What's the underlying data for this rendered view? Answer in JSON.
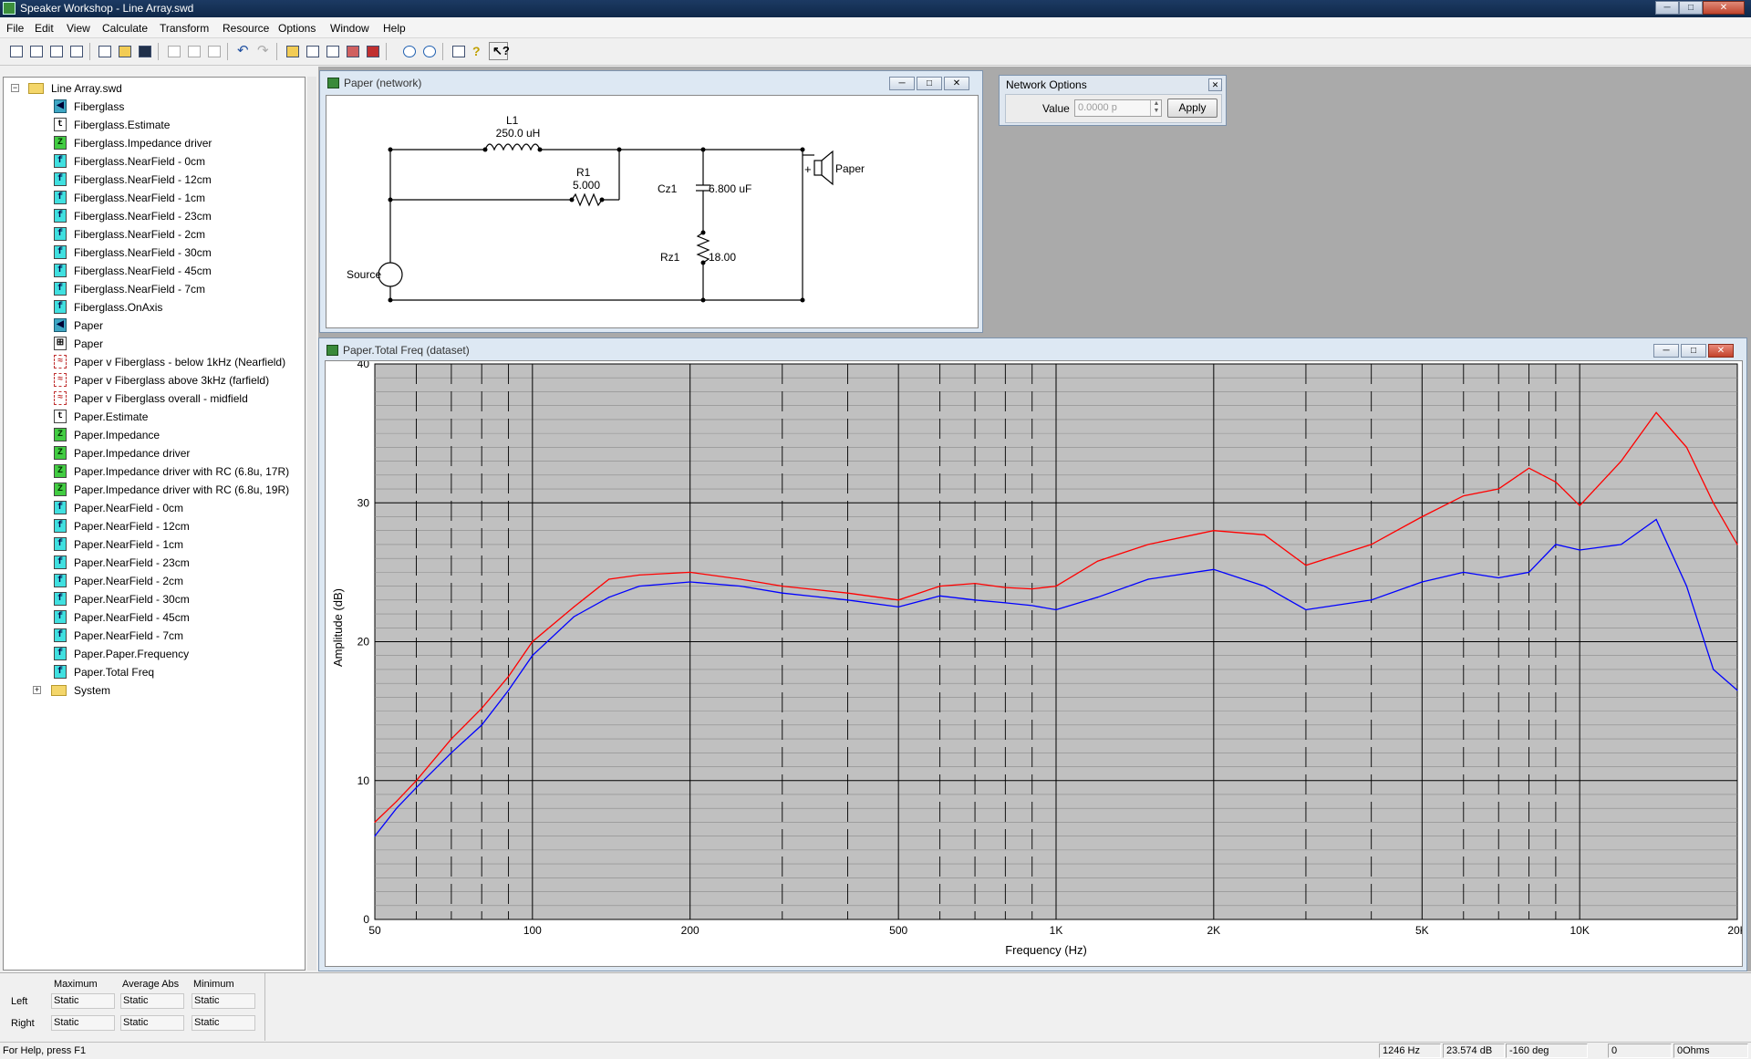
{
  "window": {
    "title": "Speaker Workshop - Line Array.swd",
    "minimize": "─",
    "maximize": "□",
    "close": "✕"
  },
  "menu": [
    "File",
    "Edit",
    "View",
    "Calculate",
    "Transform",
    "Resource",
    "Options",
    "Window",
    "Help"
  ],
  "tree": {
    "root": "Line Array.swd",
    "items": [
      {
        "label": "Fiberglass",
        "icon": "speaker-icon"
      },
      {
        "label": "Fiberglass.Estimate",
        "icon": "text-icon"
      },
      {
        "label": "Fiberglass.Impedance driver",
        "icon": "impedance-icon"
      },
      {
        "label": "Fiberglass.NearField - 0cm",
        "icon": "frequency-icon"
      },
      {
        "label": "Fiberglass.NearField - 12cm",
        "icon": "frequency-icon"
      },
      {
        "label": "Fiberglass.NearField - 1cm",
        "icon": "frequency-icon"
      },
      {
        "label": "Fiberglass.NearField - 23cm",
        "icon": "frequency-icon"
      },
      {
        "label": "Fiberglass.NearField - 2cm",
        "icon": "frequency-icon"
      },
      {
        "label": "Fiberglass.NearField - 30cm",
        "icon": "frequency-icon"
      },
      {
        "label": "Fiberglass.NearField - 45cm",
        "icon": "frequency-icon"
      },
      {
        "label": "Fiberglass.NearField - 7cm",
        "icon": "frequency-icon"
      },
      {
        "label": "Fiberglass.OnAxis",
        "icon": "frequency-icon"
      },
      {
        "label": "Paper",
        "icon": "speaker-icon"
      },
      {
        "label": "Paper",
        "icon": "network-icon"
      },
      {
        "label": "Paper v Fiberglass - below 1kHz (Nearfield)",
        "icon": "overlay-icon"
      },
      {
        "label": "Paper v Fiberglass above 3kHz (farfield)",
        "icon": "overlay-icon"
      },
      {
        "label": "Paper v Fiberglass overall - midfield",
        "icon": "overlay-icon"
      },
      {
        "label": "Paper.Estimate",
        "icon": "text-icon"
      },
      {
        "label": "Paper.Impedance",
        "icon": "impedance-icon"
      },
      {
        "label": "Paper.Impedance driver",
        "icon": "impedance-icon"
      },
      {
        "label": "Paper.Impedance driver with RC (6.8u, 17R)",
        "icon": "impedance-icon"
      },
      {
        "label": "Paper.Impedance driver with RC (6.8u, 19R)",
        "icon": "impedance-icon"
      },
      {
        "label": "Paper.NearField - 0cm",
        "icon": "frequency-icon"
      },
      {
        "label": "Paper.NearField - 12cm",
        "icon": "frequency-icon"
      },
      {
        "label": "Paper.NearField - 1cm",
        "icon": "frequency-icon"
      },
      {
        "label": "Paper.NearField - 23cm",
        "icon": "frequency-icon"
      },
      {
        "label": "Paper.NearField - 2cm",
        "icon": "frequency-icon"
      },
      {
        "label": "Paper.NearField - 30cm",
        "icon": "frequency-icon"
      },
      {
        "label": "Paper.NearField - 45cm",
        "icon": "frequency-icon"
      },
      {
        "label": "Paper.NearField - 7cm",
        "icon": "frequency-icon"
      },
      {
        "label": "Paper.Paper.Frequency",
        "icon": "frequency-icon"
      },
      {
        "label": "Paper.Total Freq",
        "icon": "frequency-icon"
      }
    ],
    "system": "System"
  },
  "network_window": {
    "title": "Paper (network)",
    "labels": {
      "l1_name": "L1",
      "l1_value": "250.0 uH",
      "r1_name": "R1",
      "r1_value": "5.000",
      "cz1_name": "Cz1",
      "cz1_value": "6.800 uF",
      "rz1_name": "Rz1",
      "rz1_value": "18.00",
      "source": "Source",
      "driver": "Paper",
      "plus": "+"
    }
  },
  "network_options": {
    "title": "Network Options",
    "value_label": "Value",
    "value": "0.0000 p",
    "apply": "Apply"
  },
  "chart_window": {
    "title": "Paper.Total Freq (dataset)"
  },
  "chart_data": {
    "type": "line",
    "title": "",
    "xlabel": "Frequency (Hz)",
    "ylabel": "Amplitude (dB)",
    "xscale": "log",
    "xlim": [
      50,
      20000
    ],
    "ylim": [
      0,
      40
    ],
    "x_ticks": [
      {
        "v": 50,
        "label": "50"
      },
      {
        "v": 100,
        "label": "100"
      },
      {
        "v": 200,
        "label": "200"
      },
      {
        "v": 500,
        "label": "500"
      },
      {
        "v": 1000,
        "label": "1K"
      },
      {
        "v": 2000,
        "label": "2K"
      },
      {
        "v": 5000,
        "label": "5K"
      },
      {
        "v": 10000,
        "label": "10K"
      },
      {
        "v": 20000,
        "label": "20K"
      }
    ],
    "y_ticks": [
      0,
      10,
      20,
      30,
      40
    ],
    "grid": true,
    "background": "#c0c0c0",
    "series": [
      {
        "color": "#ff0000",
        "x": [
          50,
          55,
          60,
          70,
          80,
          90,
          100,
          120,
          140,
          160,
          200,
          250,
          300,
          400,
          500,
          600,
          700,
          800,
          900,
          1000,
          1200,
          1500,
          2000,
          2500,
          3000,
          4000,
          5000,
          6000,
          7000,
          8000,
          9000,
          10000,
          12000,
          14000,
          16000,
          18000,
          20000
        ],
        "y": [
          7.0,
          8.5,
          10,
          13,
          15.2,
          17.5,
          20,
          22.5,
          24.5,
          24.8,
          25.0,
          24.5,
          24.0,
          23.5,
          23.0,
          24.0,
          24.2,
          23.9,
          23.8,
          24.0,
          25.8,
          27.0,
          28.0,
          27.7,
          25.5,
          27.0,
          29.0,
          30.5,
          31.0,
          32.5,
          31.5,
          29.8,
          33.0,
          36.5,
          34.0,
          30.0,
          27.0
        ]
      },
      {
        "color": "#0000ff",
        "x": [
          50,
          55,
          60,
          70,
          80,
          90,
          100,
          120,
          140,
          160,
          200,
          250,
          300,
          400,
          500,
          600,
          700,
          800,
          900,
          1000,
          1200,
          1500,
          2000,
          2500,
          3000,
          4000,
          5000,
          6000,
          7000,
          8000,
          9000,
          10000,
          12000,
          14000,
          16000,
          18000,
          20000
        ],
        "y": [
          6.0,
          8.0,
          9.5,
          12,
          14,
          16.5,
          19,
          21.8,
          23.2,
          24.0,
          24.3,
          24.0,
          23.5,
          23.0,
          22.5,
          23.3,
          23.0,
          22.8,
          22.6,
          22.3,
          23.2,
          24.5,
          25.2,
          24.0,
          22.3,
          23.0,
          24.3,
          25.0,
          24.6,
          25.0,
          27.0,
          26.6,
          27.0,
          28.8,
          24.0,
          18.0,
          16.5
        ]
      }
    ]
  },
  "stats": {
    "headers": [
      "Maximum",
      "Average Abs",
      "Minimum"
    ],
    "rows": [
      {
        "label": "Left",
        "values": [
          "Static",
          "Static",
          "Static"
        ]
      },
      {
        "label": "Right",
        "values": [
          "Static",
          "Static",
          "Static"
        ]
      }
    ]
  },
  "status": {
    "help": "For Help, press F1",
    "freq": "1246 Hz",
    "db": "23.574 dB",
    "deg": "-160 deg",
    "zero": "0",
    "ohms": "0Ohms"
  }
}
